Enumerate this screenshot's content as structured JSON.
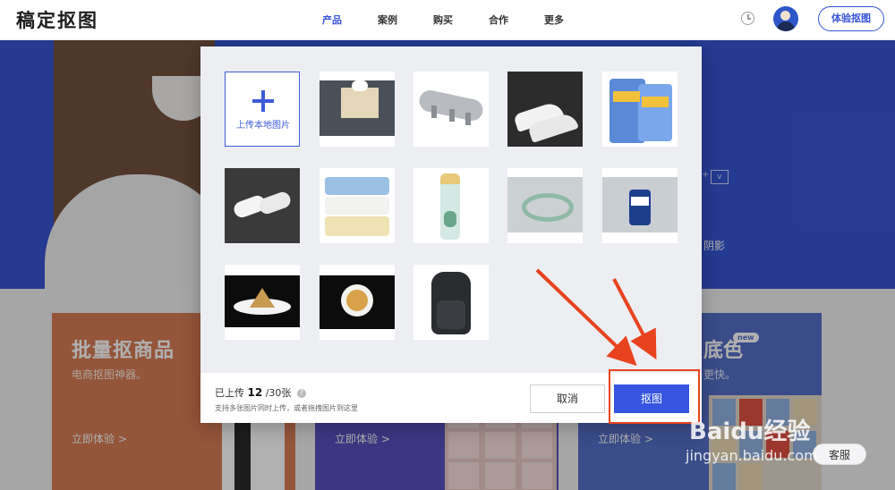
{
  "header": {
    "logo": "稿定抠图",
    "nav": [
      {
        "label": "产品",
        "active": true
      },
      {
        "label": "案例",
        "active": false
      },
      {
        "label": "购买",
        "active": false
      },
      {
        "label": "合作",
        "active": false
      },
      {
        "label": "更多",
        "active": false
      }
    ],
    "try_button": "体验抠图",
    "icons": [
      "clock-icon",
      "avatar"
    ]
  },
  "background": {
    "hero_plus": "+",
    "hero_v": "v",
    "hero_shadow_text": "阴影",
    "cards": [
      {
        "title": "批量抠商品",
        "desc": "电商抠图神器。",
        "action": "立即体验  >"
      },
      {
        "title": "",
        "desc": "",
        "action": "立即体验  >"
      },
      {
        "title_tail": "底色",
        "badge": "new",
        "desc_tail": "更快。",
        "action": "立即体验  >"
      }
    ],
    "service_button": "客服"
  },
  "modal": {
    "upload_label": "上传本地图片",
    "thumbnails": [
      "tissue-box",
      "wall-hook-rack",
      "white-sneakers",
      "detergent-bags",
      "slippers",
      "towels",
      "water-bottle",
      "jade-bangle",
      "canned-coffee",
      "zongzi",
      "noodle-bowl",
      "backpack"
    ],
    "upload_status_prefix": "已上传",
    "upload_count": "12",
    "upload_limit": "/30张",
    "hint": "支持多张图片同时上传，或者拖拽图片到这里",
    "cancel_label": "取消",
    "cutout_label": "抠图"
  },
  "watermark": {
    "brand": "Baidu经验",
    "url": "jingyan.baidu.com"
  },
  "colors": {
    "accent": "#3755e0",
    "annotation": "#e8431f",
    "hero": "#2a4bd0"
  }
}
